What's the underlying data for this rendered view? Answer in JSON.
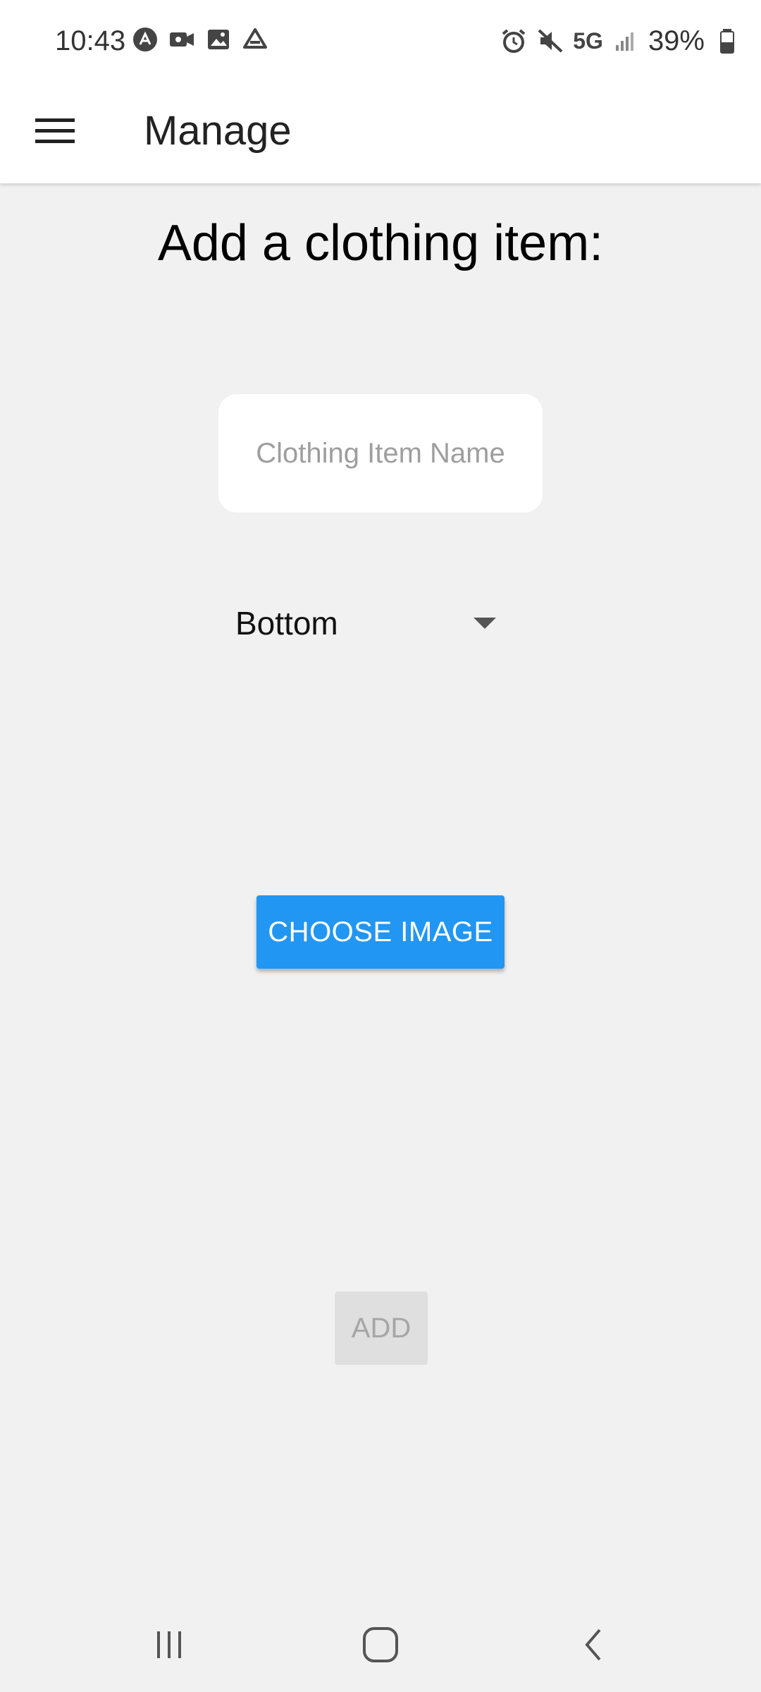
{
  "status_bar": {
    "time": "10:43",
    "left_icons": [
      "app-icon",
      "video-icon",
      "image-icon",
      "drive-icon"
    ],
    "right_icons": [
      "alarm-icon",
      "mute-icon"
    ],
    "network": "5G",
    "battery": "39%"
  },
  "app_bar": {
    "menu_icon": "hamburger-menu-icon",
    "title": "Manage"
  },
  "form": {
    "heading": "Add a clothing item:",
    "name_value": "",
    "name_placeholder": "Clothing Item Name",
    "category_selected": "Bottom",
    "choose_image_label": "CHOOSE IMAGE",
    "add_label": "ADD"
  },
  "nav_bar": {
    "buttons": [
      "recent-apps-icon",
      "home-icon",
      "back-icon"
    ]
  },
  "colors": {
    "accent": "#2196f3",
    "background": "#f1f1f1",
    "disabled_bg": "#dfdfdf",
    "disabled_text": "#a6a6a6"
  }
}
